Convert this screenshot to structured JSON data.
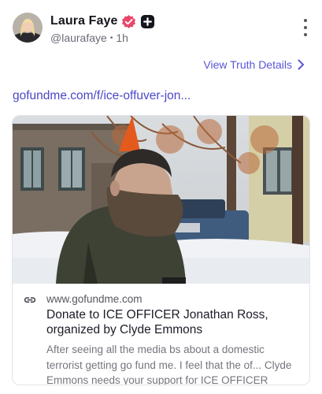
{
  "post": {
    "author": {
      "display_name": "Laura Faye",
      "handle": "@laurafaye",
      "verified_icon": "verified-badge-icon",
      "plus_icon": "plus-badge-icon",
      "separator": "•",
      "time": "1h"
    },
    "more_icon": "more-vertical-icon",
    "view_details_label": "View Truth Details",
    "link_text": "gofundme.com/f/ice-offuver-jon..."
  },
  "link_card": {
    "domain": "www.gofundme.com",
    "title": "Donate to ICE OFFICER Jonathan Ross, organized by Clyde Emmons",
    "description": "After seeing all the media bs about a domestic terrorist getting go fund me. I feel that the of... Clyde Emmons needs your support for ICE OFFICER Jonathan Ross",
    "link_icon": "link-icon"
  },
  "colors": {
    "accent": "#5a55d6",
    "link": "#4b48c9",
    "verified": "#e8476a",
    "text": "#1c1c28",
    "muted": "#6b6b78"
  }
}
